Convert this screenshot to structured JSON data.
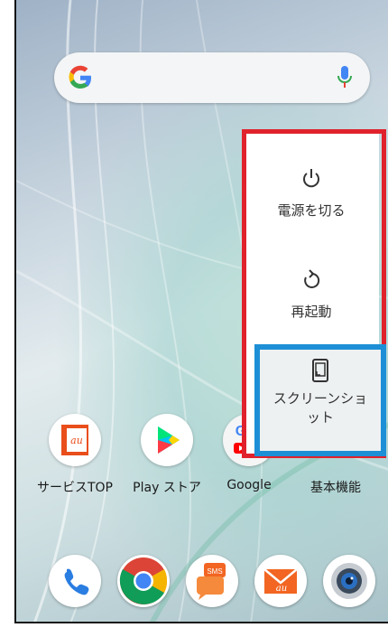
{
  "search": {
    "logo_letter": "G",
    "mic_color": "#f4b400"
  },
  "power_menu": {
    "power_off_label": "電源を切る",
    "restart_label": "再起動",
    "screenshot_label": "スクリーンショット",
    "screenshot_label_line1": "スクリーンショ",
    "screenshot_label_line2": "ット"
  },
  "apps": [
    {
      "name": "サービスTOP",
      "icon": "au-service-top-icon"
    },
    {
      "name": "Play ストア",
      "icon": "play-store-icon"
    },
    {
      "name": "Google",
      "icon": "google-folder-icon"
    },
    {
      "name": "基本機能",
      "icon": "basic-functions-folder-icon"
    }
  ],
  "dock": [
    {
      "icon": "phone-icon"
    },
    {
      "icon": "chrome-icon"
    },
    {
      "icon": "sms-icon",
      "badge": "SMS"
    },
    {
      "icon": "au-mail-icon",
      "badge": "au"
    },
    {
      "icon": "camera-icon"
    }
  ],
  "colors": {
    "highlight_red": "#e0222c",
    "highlight_blue": "#1d8fd6"
  }
}
